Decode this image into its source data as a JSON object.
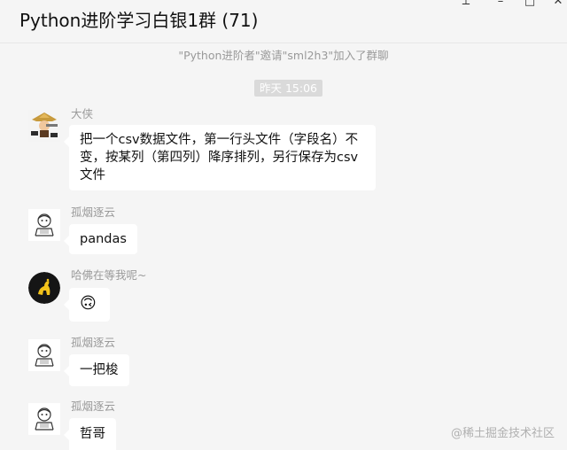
{
  "window": {
    "title": "Python进阶学习白银1群 (71)"
  },
  "notice": "\"Python进阶者\"邀请\"sml2h3\"加入了群聊",
  "time_divider": "昨天 15:06",
  "messages": [
    {
      "sender": "大侠",
      "text": "把一个csv数据文件，第一行头文件（字段名）不变，按某列（第四列）降序排列，另行保存为csv 文件",
      "avatar": "warrior-avatar"
    },
    {
      "sender": "孤烟逐云",
      "text": "pandas",
      "avatar": "sketch-avatar"
    },
    {
      "sender": "哈佛在等我呢~",
      "text": "🙃",
      "avatar": "ferrari-avatar"
    },
    {
      "sender": "孤烟逐云",
      "text": "一把梭",
      "avatar": "sketch-avatar"
    },
    {
      "sender": "孤烟逐云",
      "text": "哲哥",
      "avatar": "sketch-avatar"
    }
  ],
  "watermark": "@稀土掘金技术社区",
  "colors": {
    "background": "#f5f5f5",
    "bubble": "#ffffff",
    "time_badge": "#dadada",
    "meta_text": "#999999"
  }
}
